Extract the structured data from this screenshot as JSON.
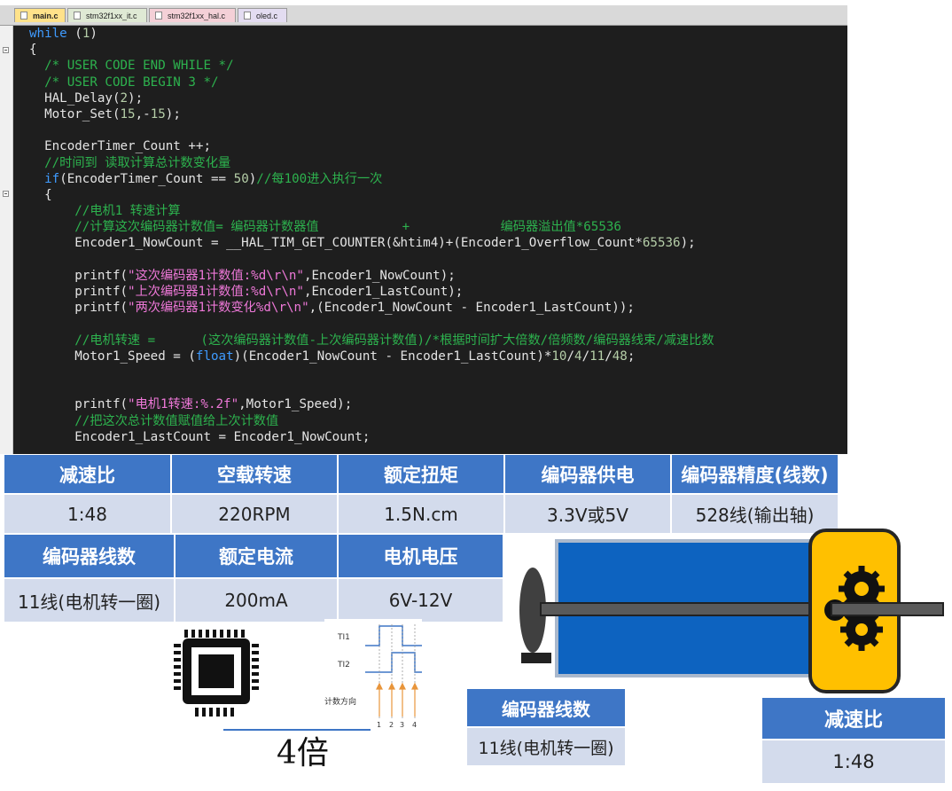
{
  "editor": {
    "tabs": [
      {
        "label": "main.c",
        "active": true
      },
      {
        "label": "stm32f1xx_it.c",
        "active": false
      },
      {
        "label": "stm32f1xx_hal.c",
        "active": false
      },
      {
        "label": "oled.c",
        "active": false
      }
    ],
    "lines": [
      "<span class=\"kw\">while</span> (<span class=\"num\">1</span>)",
      "{",
      "  <span class=\"cmt\">/* USER CODE END WHILE */</span>",
      "  <span class=\"cmt\">/* USER CODE BEGIN 3 */</span>",
      "  HAL_Delay(<span class=\"num\">2</span>);",
      "  Motor_Set(<span class=\"num\">15</span>,-<span class=\"num\">15</span>);",
      "",
      "  EncoderTimer_Count ++;",
      "  <span class=\"cmt\">//时间到 读取计算总计数变化量</span>",
      "  <span class=\"kw\">if</span>(EncoderTimer_Count == <span class=\"num\">50</span>)<span class=\"cmt\">//每100进入执行一次</span>",
      "  {",
      "      <span class=\"cmt\">//电机1 转速计算</span>",
      "      <span class=\"cmt\">//计算这次编码器计数值= 编码器计数器值           +            编码器溢出值*65536</span>",
      "      Encoder1_NowCount = __HAL_TIM_GET_COUNTER(&amp;htim4)+(Encoder1_Overflow_Count*<span class=\"num\">65536</span>);",
      "",
      "      printf(<span class=\"str\">\"这次编码器1计数值:%d\\r\\n\"</span>,Encoder1_NowCount);",
      "      printf(<span class=\"str\">\"上次编码器1计数值:%d\\r\\n\"</span>,Encoder1_LastCount);",
      "      printf(<span class=\"str\">\"两次编码器1计数变化%d\\r\\n\"</span>,(Encoder1_NowCount - Encoder1_LastCount));",
      "",
      "      <span class=\"cmt\">//电机转速 =      (这次编码器计数值-上次编码器计数值)/*根据时间扩大倍数/倍频数/编码器线束/减速比数</span>",
      "      Motor1_Speed = (<span class=\"kw\">float</span>)(Encoder1_NowCount - Encoder1_LastCount)*<span class=\"num\">10</span>/<span class=\"num\">4</span>/<span class=\"num\">11</span>/<span class=\"num\">48</span>;",
      "",
      "",
      "      printf(<span class=\"str\">\"电机1转速:%.2f\"</span>,Motor1_Speed);",
      "      <span class=\"cmt\">//把这次总计数值赋值给上次计数值</span>",
      "      Encoder1_LastCount = Encoder1_NowCount;"
    ]
  },
  "specs": {
    "row1_headers": [
      "减速比",
      "空载转速",
      "额定扭矩",
      "编码器供电",
      "编码器精度(线数)"
    ],
    "row1_values": [
      "1:48",
      "220RPM",
      "1.5N.cm",
      "3.3V或5V",
      "528线(输出轴)"
    ],
    "row2_headers": [
      "编码器线数",
      "额定电流",
      "电机电压"
    ],
    "row2_values": [
      "11线(电机转一圈)",
      "200mA",
      "6V-12V"
    ]
  },
  "diagram": {
    "timing_labels": [
      "TI1",
      "TI2",
      "计数方向"
    ],
    "timing_ticks": [
      "1",
      "2",
      "3",
      "4"
    ],
    "multiplier": "4倍",
    "encoder_box": {
      "header": "编码器线数",
      "value": "11线(电机转一圈)"
    },
    "reduction_box": {
      "header": "减速比",
      "value": "1:48"
    }
  },
  "colors": {
    "header_blue": "#3e76c6",
    "value_gray": "#d3dbec",
    "motor_blue": "#0d63c0",
    "gearbox_yellow": "#ffc000"
  }
}
